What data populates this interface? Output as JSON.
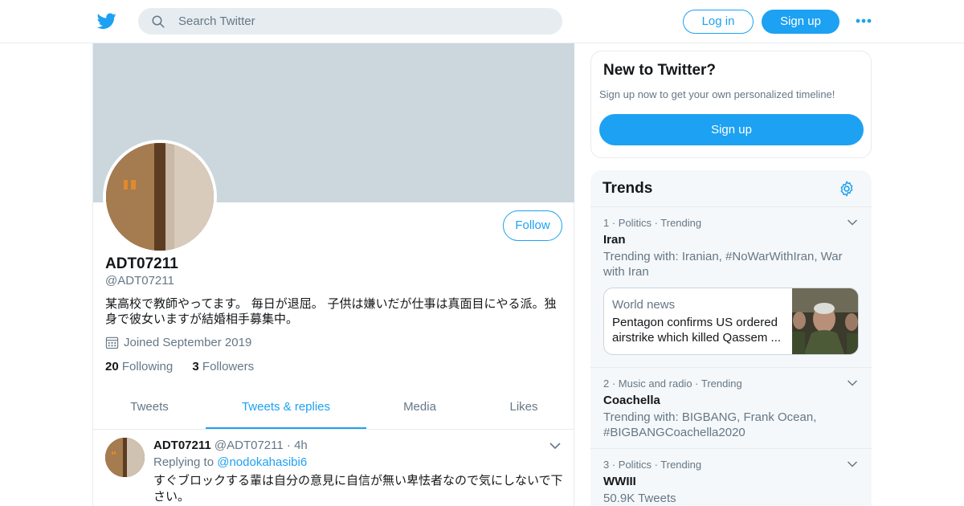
{
  "header": {
    "logo_icon": "twitter-bird-icon",
    "search_placeholder": "Search Twitter",
    "login_label": "Log in",
    "signup_label": "Sign up",
    "more_icon": "more-dots-icon",
    "accent_color": "#1da1f2"
  },
  "profile": {
    "display_name": "ADT07211",
    "handle": "@ADT07211",
    "bio": "某高校で教師やってます。 毎日が退屈。 子供は嫌いだが仕事は真面目にやる派。独身で彼女いますが結婚相手募集中。",
    "joined": "Joined September 2019",
    "following_count": "20",
    "following_label": "Following",
    "followers_count": "3",
    "followers_label": "Followers",
    "follow_label": "Follow"
  },
  "tabs": [
    {
      "label": "Tweets",
      "active": false
    },
    {
      "label": "Tweets & replies",
      "active": true
    },
    {
      "label": "Media",
      "active": false
    },
    {
      "label": "Likes",
      "active": false
    }
  ],
  "tweet": {
    "author_name": "ADT07211",
    "author_handle": "@ADT07211",
    "separator": "·",
    "time": "4h",
    "replying_prefix": "Replying to",
    "replying_to": "@nodokahasibi6",
    "text": "すぐブロックする輩は自分の意見に自信が無い卑怯者なので気にしないで下さい。"
  },
  "signup_box": {
    "title": "New to Twitter?",
    "subtitle": "Sign up now to get your own personalized timeline!",
    "button_label": "Sign up"
  },
  "trends": {
    "title": "Trends",
    "settings_icon": "gear-icon",
    "items": [
      {
        "context": "1 · Politics · Trending",
        "name": "Iran",
        "with": "Trending with: Iranian, #NoWarWithIran, War with Iran",
        "card": {
          "source": "World news",
          "headline": "Pentagon confirms US ordered airstrike which killed Qassem ..."
        }
      },
      {
        "context": "2 · Music and radio · Trending",
        "name": "Coachella",
        "with": "Trending with: BIGBANG, Frank Ocean, #BIGBANGCoachella2020"
      },
      {
        "context": "3 · Politics · Trending",
        "name": "WWIII",
        "with": "50.9K Tweets"
      }
    ]
  }
}
